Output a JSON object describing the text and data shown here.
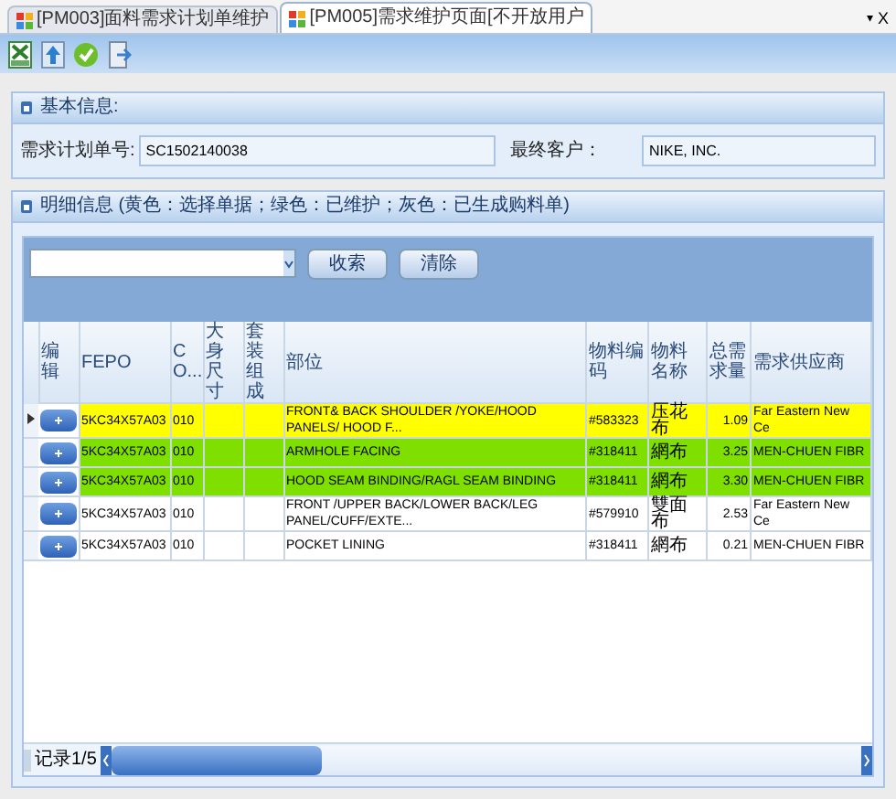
{
  "tabs": [
    {
      "label": "[PM003]面料需求计划单维护",
      "selected": false
    },
    {
      "label": "[PM005]需求维护页面[不开放用户",
      "selected": true
    }
  ],
  "tab_controls": {
    "menu": "▾",
    "close": "X"
  },
  "basic_info": {
    "title": "基本信息:",
    "fields": [
      {
        "label": "需求计划单号:",
        "value": "SC1502140038"
      },
      {
        "label": "最终客户：",
        "value": "NIKE, INC."
      }
    ]
  },
  "detail": {
    "title": "明细信息 (黄色：选择单据；绿色：已维护；灰色：已生成购料单)",
    "search_buttons": [
      "收索",
      "清除"
    ],
    "columns": [
      "编辑",
      "FEPO",
      "CO...",
      "大身尺寸",
      "套装组成",
      "部位",
      "物料编码",
      "物料名称",
      "总需求量",
      "需求供应商"
    ],
    "rows": [
      {
        "selected": true,
        "color": "#ffff00",
        "cells": [
          "",
          "5KC34X57A03",
          "010",
          "",
          "",
          "FRONT& BACK SHOULDER /YOKE/HOOD PANELS/ HOOD F...",
          "#583323",
          "压花布",
          "1.09",
          "Far Eastern New Ce"
        ]
      },
      {
        "selected": false,
        "color": "#7fe000",
        "cells": [
          "",
          "5KC34X57A03",
          "010",
          "",
          "",
          "ARMHOLE FACING",
          "#318411",
          "網布",
          "3.25",
          "MEN-CHUEN FIBR"
        ]
      },
      {
        "selected": false,
        "color": "#7fe000",
        "cells": [
          "",
          "5KC34X57A03",
          "010",
          "",
          "",
          "HOOD SEAM BINDING/RAGL SEAM BINDING",
          "#318411",
          "網布",
          "3.30",
          "MEN-CHUEN FIBR"
        ]
      },
      {
        "selected": false,
        "color": "#ffffff",
        "cells": [
          "",
          "5KC34X57A03",
          "010",
          "",
          "",
          "FRONT /UPPER BACK/LOWER BACK/LEG PANEL/CUFF/EXTE...",
          "#579910",
          "雙面布",
          "2.53",
          "Far Eastern New Ce"
        ]
      },
      {
        "selected": false,
        "color": "#ffffff",
        "cells": [
          "",
          "5KC34X57A03",
          "010",
          "",
          "",
          "POCKET LINING",
          "#318411",
          "網布",
          "0.21",
          "MEN-CHUEN FIBR"
        ]
      }
    ],
    "record": "记录1/5"
  }
}
